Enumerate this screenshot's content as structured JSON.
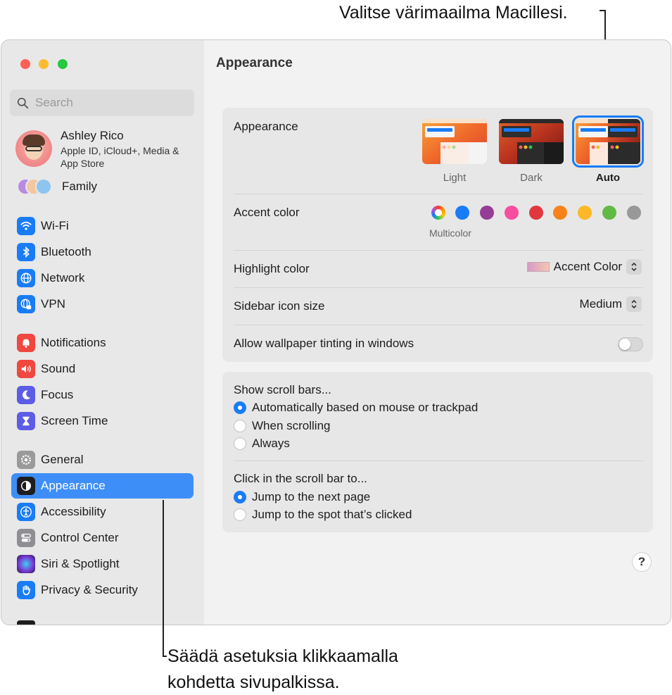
{
  "callouts": {
    "top": "Valitse värimaailma Macillesi.",
    "bottom_line1": "Säädä asetuksia klikkaamalla",
    "bottom_line2": "kohdetta sivupalkissa."
  },
  "sidebar": {
    "search_placeholder": "Search",
    "profile": {
      "name": "Ashley Rico",
      "subtitle": "Apple ID, iCloud+, Media & App Store"
    },
    "family_label": "Family",
    "items": [
      {
        "label": "Wi-Fi",
        "icon": "wifi-icon",
        "color": "#1a7cf5"
      },
      {
        "label": "Bluetooth",
        "icon": "bluetooth-icon",
        "color": "#1a7cf5"
      },
      {
        "label": "Network",
        "icon": "globe-icon",
        "color": "#1a7cf5"
      },
      {
        "label": "VPN",
        "icon": "vpn-icon",
        "color": "#1a7cf5"
      },
      {
        "label": "Notifications",
        "icon": "bell-icon",
        "color": "#f0473f"
      },
      {
        "label": "Sound",
        "icon": "speaker-icon",
        "color": "#f0473f"
      },
      {
        "label": "Focus",
        "icon": "moon-icon",
        "color": "#5d5ce6"
      },
      {
        "label": "Screen Time",
        "icon": "hourglass-icon",
        "color": "#5d5ce6"
      },
      {
        "label": "General",
        "icon": "gear-icon",
        "color": "#9a9a9a"
      },
      {
        "label": "Appearance",
        "icon": "appearance-icon",
        "color": "#1d1d1f"
      },
      {
        "label": "Accessibility",
        "icon": "accessibility-icon",
        "color": "#1a7cf5"
      },
      {
        "label": "Control Center",
        "icon": "control-center-icon",
        "color": "#8e8e93"
      },
      {
        "label": "Siri & Spotlight",
        "icon": "siri-icon",
        "color": "#a24fd6"
      },
      {
        "label": "Privacy & Security",
        "icon": "hand-icon",
        "color": "#1a7cf5"
      }
    ]
  },
  "main": {
    "title": "Appearance",
    "appearance_label": "Appearance",
    "modes": [
      "Light",
      "Dark",
      "Auto"
    ],
    "selected_mode": "Auto",
    "accent_label": "Accent color",
    "accent_colors": [
      "multicolor",
      "#1a7cf5",
      "#953d96",
      "#f74f9e",
      "#e0383e",
      "#f7821b",
      "#fcb827",
      "#62ba46",
      "#989898"
    ],
    "multicolor_label": "Multicolor",
    "highlight_label": "Highlight color",
    "highlight_value": "Accent Color",
    "sidebar_icon_label": "Sidebar icon size",
    "sidebar_icon_value": "Medium",
    "tinting_label": "Allow wallpaper tinting in windows",
    "tinting_on": false,
    "scroll_bars_title": "Show scroll bars...",
    "scroll_options": [
      "Automatically based on mouse or trackpad",
      "When scrolling",
      "Always"
    ],
    "click_title": "Click in the scroll bar to...",
    "click_options": [
      "Jump to the next page",
      "Jump to the spot that’s clicked"
    ],
    "help": "?"
  }
}
